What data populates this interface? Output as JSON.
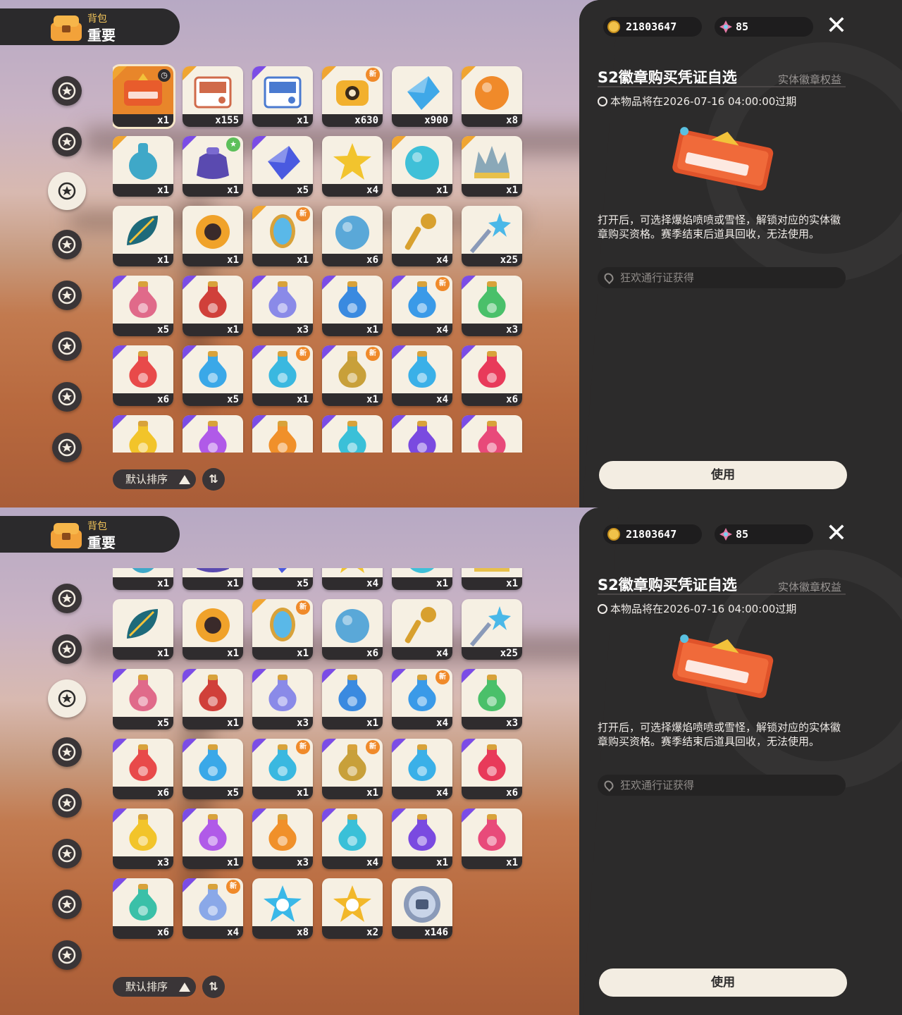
{
  "header": {
    "small_label": "背包",
    "big_label": "重要"
  },
  "currency": {
    "coins": "21803647",
    "gems": "85"
  },
  "categories": [
    "star-badge",
    "leaf",
    "spiky-star",
    "clover",
    "ribbon-scroll",
    "dots-ball",
    "acorn",
    "sofa"
  ],
  "active_category": 2,
  "sort": {
    "label": "默认排序"
  },
  "detail": {
    "title": "S2徽章购买凭证自选",
    "tag": "实体徽章权益",
    "expiry": "本物品将在2026-07-16 04:00:00过期",
    "description": "打开后，可选择爆焰喷喷或雪怪，解锁对应的实体徽章购买资格。赛季结束后道具回收，无法使用。",
    "source": "狂欢通行证获得",
    "use_label": "使用"
  },
  "items": [
    {
      "qty": "x1",
      "kind": "ticket",
      "c": "#e85c2c",
      "rar": "gold",
      "badge": "timer"
    },
    {
      "qty": "x155",
      "kind": "card",
      "c": "#d06a4a",
      "rar": "gold"
    },
    {
      "qty": "x1",
      "kind": "card",
      "c": "#4a7ad0",
      "rar": "purple"
    },
    {
      "qty": "x630",
      "kind": "camera",
      "c": "#f2b02e",
      "rar": "gold",
      "badge": "new"
    },
    {
      "qty": "x900",
      "kind": "crystal",
      "c": "#3fa8e8",
      "rar": "none"
    },
    {
      "qty": "x8",
      "kind": "orb",
      "c": "#f08a2a",
      "rar": "gold"
    },
    {
      "qty": "x1",
      "kind": "vase",
      "c": "#3fa8c8",
      "rar": "gold"
    },
    {
      "qty": "x1",
      "kind": "bag",
      "c": "#5a4ab0",
      "rar": "purple",
      "badge": "star"
    },
    {
      "qty": "x5",
      "kind": "crystal",
      "c": "#4a5ae0",
      "rar": "purple"
    },
    {
      "qty": "x4",
      "kind": "star",
      "c": "#f2c42e",
      "rar": "none"
    },
    {
      "qty": "x1",
      "kind": "orb",
      "c": "#3fc0d8",
      "rar": "gold"
    },
    {
      "qty": "x1",
      "kind": "crown",
      "c": "#8aa8b8",
      "rar": "gold"
    },
    {
      "qty": "x1",
      "kind": "leaf",
      "c": "#1e6a7a",
      "rar": "none"
    },
    {
      "qty": "x1",
      "kind": "flower",
      "c": "#f0a22a",
      "rar": "none"
    },
    {
      "qty": "x1",
      "kind": "mirror",
      "c": "#5ab8e8",
      "rar": "gold",
      "badge": "new"
    },
    {
      "qty": "x6",
      "kind": "orb",
      "c": "#5aa8d8",
      "rar": "none"
    },
    {
      "qty": "x4",
      "kind": "key",
      "c": "#d8a02e",
      "rar": "none"
    },
    {
      "qty": "x25",
      "kind": "wand",
      "c": "#4ab8e8",
      "rar": "none"
    },
    {
      "qty": "x5",
      "kind": "potion",
      "c": "#e06a8a",
      "rar": "purple"
    },
    {
      "qty": "x1",
      "kind": "potion",
      "c": "#d0403a",
      "rar": "purple"
    },
    {
      "qty": "x3",
      "kind": "potion",
      "c": "#8a8ae8",
      "rar": "purple"
    },
    {
      "qty": "x1",
      "kind": "potion",
      "c": "#3a8ae0",
      "rar": "purple"
    },
    {
      "qty": "x4",
      "kind": "potion",
      "c": "#3a9ae8",
      "rar": "purple",
      "badge": "new"
    },
    {
      "qty": "x3",
      "kind": "potion",
      "c": "#4ac06a",
      "rar": "purple"
    },
    {
      "qty": "x6",
      "kind": "potion",
      "c": "#e84a4a",
      "rar": "purple"
    },
    {
      "qty": "x5",
      "kind": "potion",
      "c": "#3aa8e8",
      "rar": "purple"
    },
    {
      "qty": "x1",
      "kind": "potion",
      "c": "#3ab8e0",
      "rar": "purple",
      "badge": "new"
    },
    {
      "qty": "x1",
      "kind": "potion",
      "c": "#c8a03a",
      "rar": "purple",
      "badge": "new"
    },
    {
      "qty": "x4",
      "kind": "potion",
      "c": "#3ab0e8",
      "rar": "purple"
    },
    {
      "qty": "x6",
      "kind": "potion",
      "c": "#e83a5a",
      "rar": "purple"
    },
    {
      "qty": "x3",
      "kind": "potion",
      "c": "#f2c42a",
      "rar": "purple"
    },
    {
      "qty": "x1",
      "kind": "potion",
      "c": "#b05ae8",
      "rar": "purple"
    },
    {
      "qty": "x3",
      "kind": "potion",
      "c": "#f0902a",
      "rar": "purple"
    },
    {
      "qty": "x4",
      "kind": "potion",
      "c": "#3ac0d8",
      "rar": "purple"
    },
    {
      "qty": "x1",
      "kind": "potion",
      "c": "#7a4ae0",
      "rar": "purple"
    },
    {
      "qty": "x1",
      "kind": "potion",
      "c": "#e84a7a",
      "rar": "purple"
    },
    {
      "qty": "x6",
      "kind": "potion",
      "c": "#3ac0a8",
      "rar": "purple"
    },
    {
      "qty": "x4",
      "kind": "potion",
      "c": "#8aa8e8",
      "rar": "purple",
      "badge": "new"
    },
    {
      "qty": "x8",
      "kind": "starcoin",
      "c": "#3ab8e8",
      "rar": "none"
    },
    {
      "qty": "x2",
      "kind": "starcoin",
      "c": "#f2b82a",
      "rar": "none"
    },
    {
      "qty": "x146",
      "kind": "coin",
      "c": "#8a9ab8",
      "rar": "none"
    }
  ]
}
